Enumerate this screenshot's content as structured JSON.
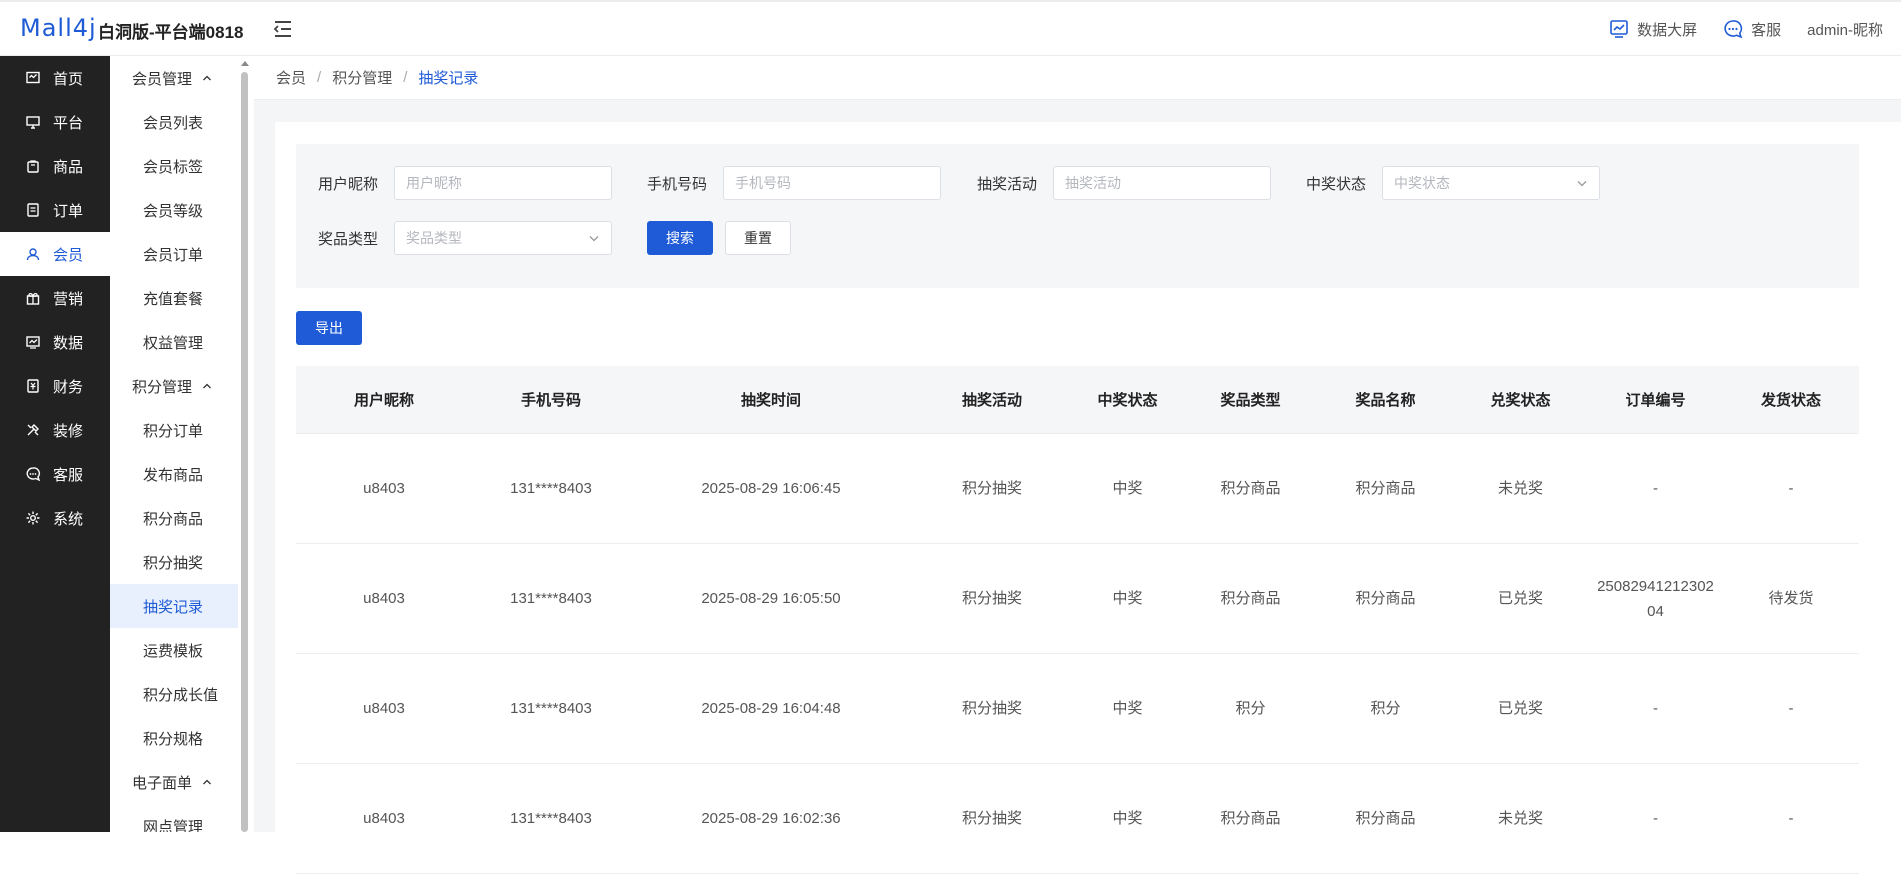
{
  "header": {
    "logo": "Mall4j",
    "title": "白洞版-平台端0818",
    "data_screen": "数据大屏",
    "customer_service": "客服",
    "user": "admin-昵称"
  },
  "nav": {
    "items": [
      {
        "label": "首页",
        "icon": "home-icon"
      },
      {
        "label": "平台",
        "icon": "monitor-icon"
      },
      {
        "label": "商品",
        "icon": "bag-icon"
      },
      {
        "label": "订单",
        "icon": "order-icon"
      },
      {
        "label": "会员",
        "icon": "member-icon"
      },
      {
        "label": "营销",
        "icon": "gift-icon"
      },
      {
        "label": "数据",
        "icon": "data-icon"
      },
      {
        "label": "财务",
        "icon": "finance-icon"
      },
      {
        "label": "装修",
        "icon": "decorate-icon"
      },
      {
        "label": "客服",
        "icon": "chat-icon"
      },
      {
        "label": "系统",
        "icon": "settings-icon"
      }
    ],
    "active": "会员"
  },
  "subnav": {
    "member_group": "会员管理",
    "member_items": [
      "会员列表",
      "会员标签",
      "会员等级",
      "会员订单",
      "充值套餐",
      "权益管理"
    ],
    "points_group": "积分管理",
    "points_items": [
      "积分订单",
      "发布商品",
      "积分商品",
      "积分抽奖",
      "抽奖记录",
      "运费模板",
      "积分成长值",
      "积分规格"
    ],
    "waybill_group": "电子面单",
    "waybill_items": [
      "网点管理"
    ],
    "active": "抽奖记录"
  },
  "breadcrumb": [
    "会员",
    "积分管理",
    "抽奖记录"
  ],
  "filters": {
    "nickname_label": "用户昵称",
    "nickname_placeholder": "用户昵称",
    "phone_label": "手机号码",
    "phone_placeholder": "手机号码",
    "activity_label": "抽奖活动",
    "activity_placeholder": "抽奖活动",
    "status_label": "中奖状态",
    "status_placeholder": "中奖状态",
    "prize_type_label": "奖品类型",
    "prize_type_placeholder": "奖品类型",
    "search_button": "搜索",
    "reset_button": "重置"
  },
  "export_button": "导出",
  "table": {
    "columns": [
      "用户昵称",
      "手机号码",
      "抽奖时间",
      "抽奖活动",
      "中奖状态",
      "奖品类型",
      "奖品名称",
      "兑奖状态",
      "订单编号",
      "发货状态"
    ],
    "rows": [
      [
        "u8403",
        "131****8403",
        "2025-08-29 16:06:45",
        "积分抽奖",
        "中奖",
        "积分商品",
        "积分商品",
        "未兑奖",
        "-",
        "-"
      ],
      [
        "u8403",
        "131****8403",
        "2025-08-29 16:05:50",
        "积分抽奖",
        "中奖",
        "积分商品",
        "积分商品",
        "已兑奖",
        "2508294121230204",
        "待发货"
      ],
      [
        "u8403",
        "131****8403",
        "2025-08-29 16:04:48",
        "积分抽奖",
        "中奖",
        "积分",
        "积分",
        "已兑奖",
        "-",
        "-"
      ],
      [
        "u8403",
        "131****8403",
        "2025-08-29 16:02:36",
        "积分抽奖",
        "中奖",
        "积分商品",
        "积分商品",
        "未兑奖",
        "-",
        "-"
      ]
    ]
  },
  "colors": {
    "accent": "#1f5bd6",
    "nav_bg": "#222222",
    "page_bg": "#f4f5f7"
  }
}
